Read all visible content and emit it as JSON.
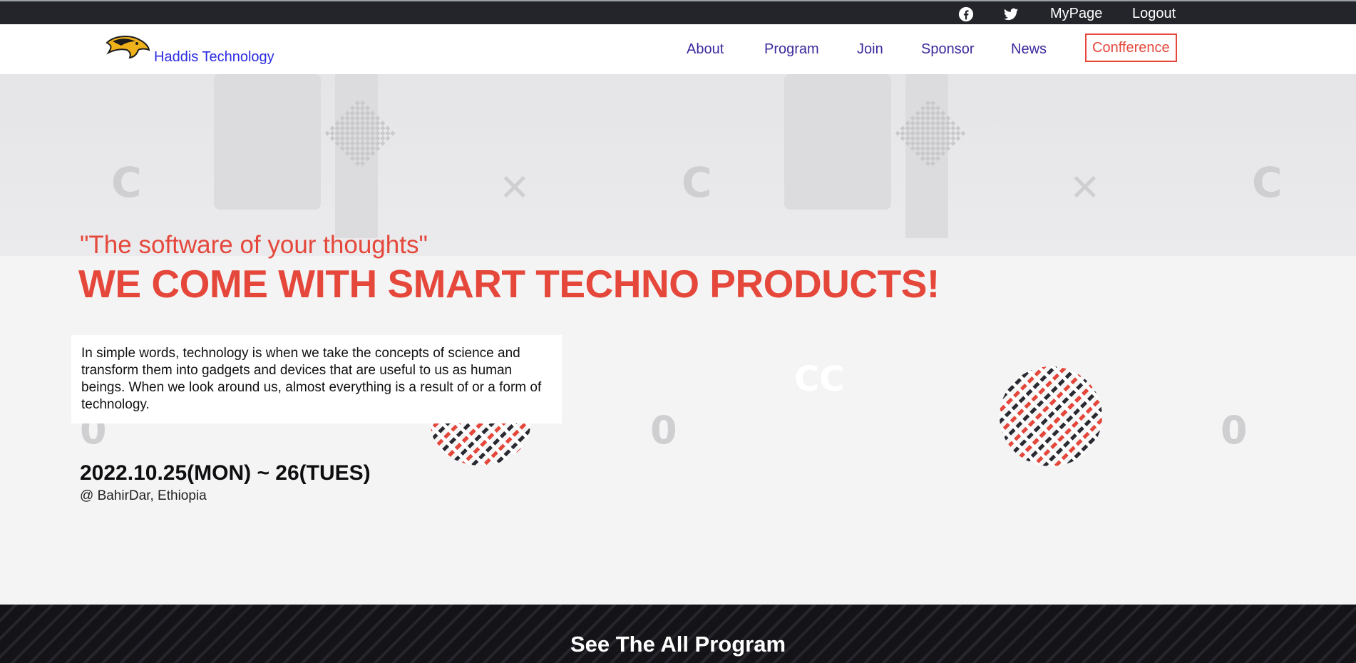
{
  "topbar": {
    "facebook_icon": "facebook-icon",
    "twitter_icon": "twitter-icon",
    "mypage_label": "MyPage",
    "logout_label": "Logout"
  },
  "header": {
    "brand": "Haddis Technology",
    "logo_icon": "eagle-logo",
    "nav": [
      {
        "label": "About"
      },
      {
        "label": "Program"
      },
      {
        "label": "Join"
      },
      {
        "label": "Sponsor"
      },
      {
        "label": "News"
      },
      {
        "label": "Confference",
        "active": true
      }
    ]
  },
  "hero": {
    "quote": "\"The software of your thoughts\"",
    "headline": "WE COME WITH SMART TECHNO PRODUCTS!",
    "description": "In simple words, technology is when we take the concepts of science and transform them into gadgets and devices that are useful to us as human beings. When we look around us, almost everything is a result of or a form of technology.",
    "date": "2022.10.25(MON) ~ 26(TUES)",
    "venue": "@ BahirDar, Ethiopia"
  },
  "band": {
    "title": "See The All Program"
  },
  "colors": {
    "accent": "#e5473b",
    "nav": "#3b2a9c",
    "brand": "#2c2ce0",
    "topbar": "#23252a",
    "band": "#141418"
  }
}
